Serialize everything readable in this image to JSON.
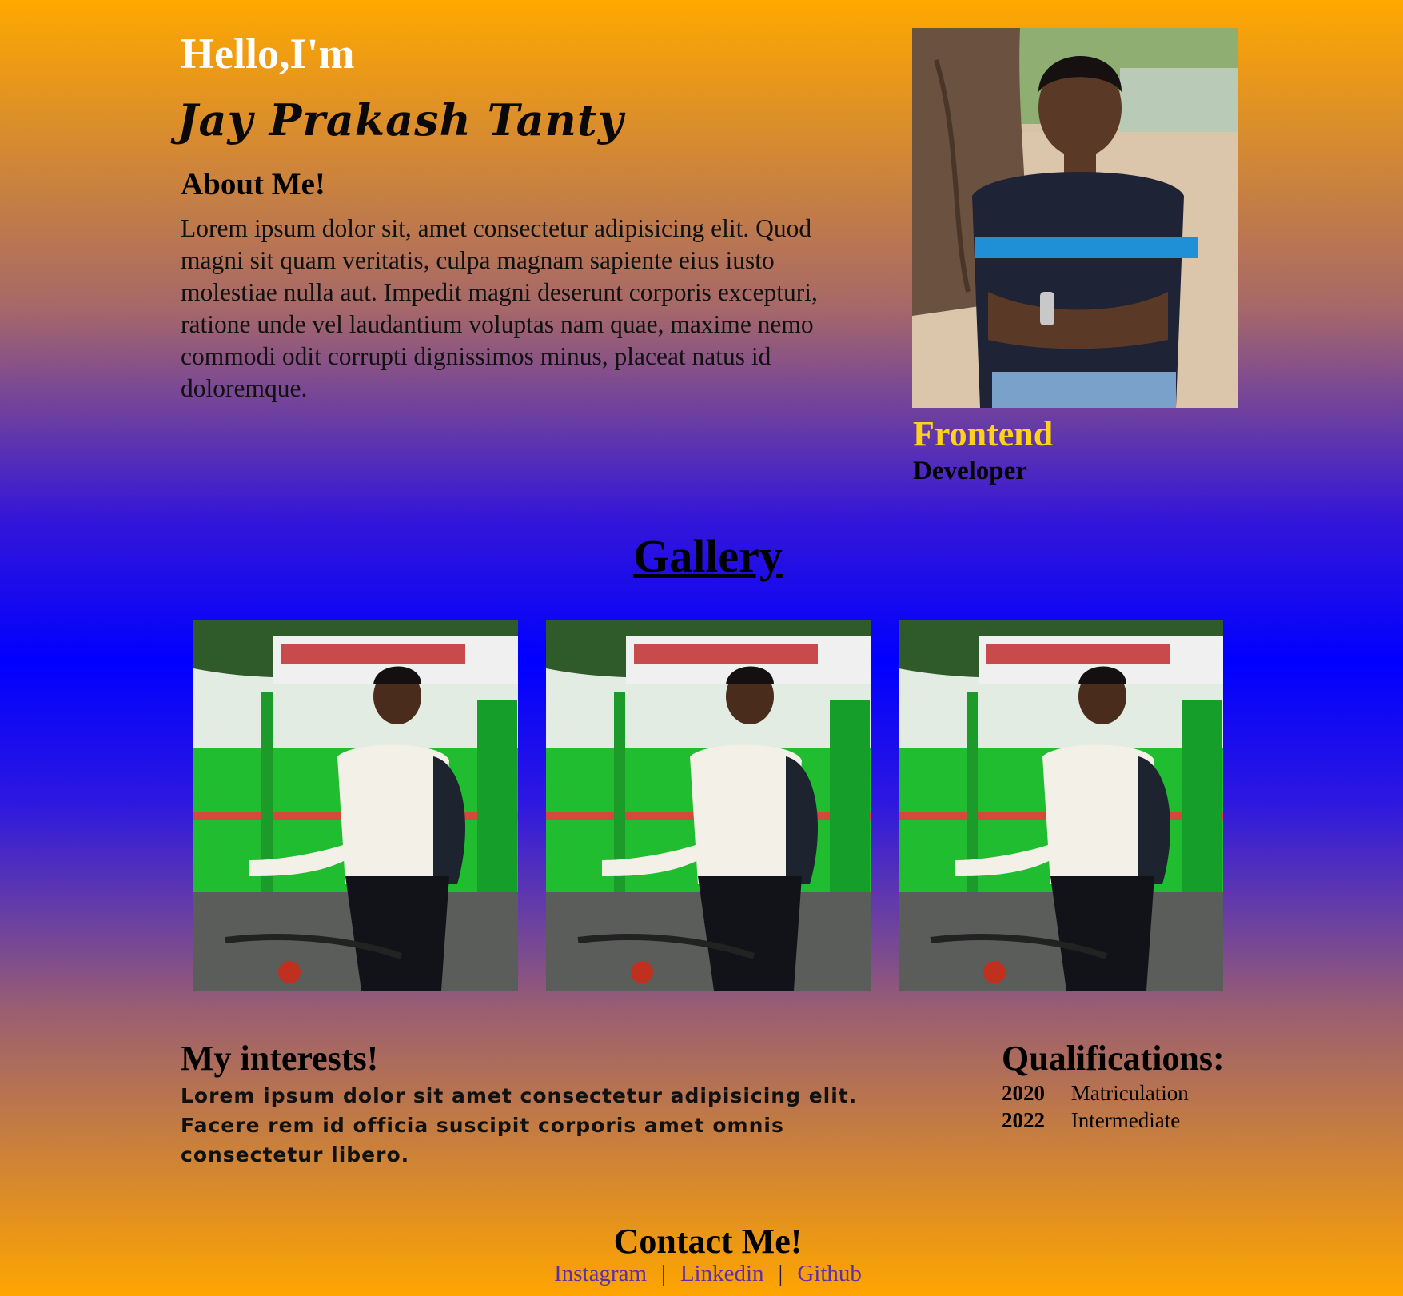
{
  "hero": {
    "greeting": "Hello,I'm",
    "name": "Jay Prakash Tanty",
    "about_title": "About Me!",
    "about_text": "Lorem ipsum dolor sit, amet consectetur adipisicing elit. Quod magni sit quam veritatis, culpa magnam sapiente eius iusto molestiae nulla aut. Impedit magni deserunt corporis excepturi, ratione unde vel laudantium voluptas nam quae, maxime nemo commodi odit corrupti dignissimos minus, placeat natus id doloremque.",
    "role_primary": "Frontend",
    "role_secondary": "Developer"
  },
  "gallery": {
    "title": "Gallery",
    "image_count": 3
  },
  "interests": {
    "title": "My interests!",
    "text": "Lorem ipsum dolor sit amet consectetur adipisicing elit. Facere rem id officia suscipit corporis amet omnis consectetur libero."
  },
  "qualifications": {
    "title": "Qualifications:",
    "items": [
      {
        "year": "2020",
        "label": "Matriculation"
      },
      {
        "year": "2022",
        "label": "Intermediate"
      }
    ]
  },
  "contact": {
    "title": "Contact Me!",
    "links": [
      "Instagram",
      "Linkedin",
      "Github"
    ],
    "separator": "|"
  },
  "colors": {
    "accent_role": "#ffd21a",
    "link": "#5c2faa",
    "gradient_top": "#ffa800",
    "gradient_mid": "#0000ff"
  }
}
